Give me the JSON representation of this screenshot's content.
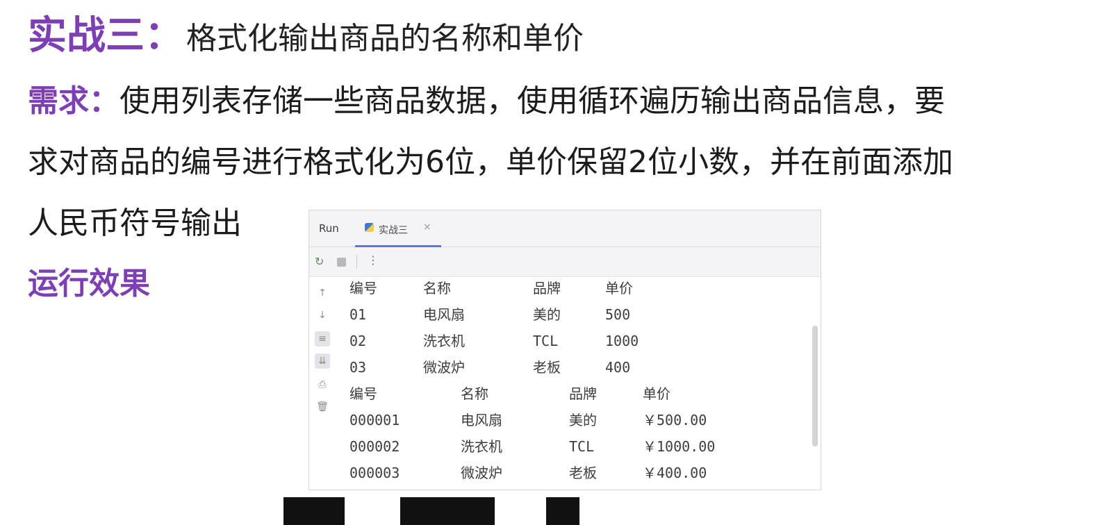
{
  "slide": {
    "title_prefix": "实战三：",
    "title_text": "格式化输出商品的名称和单价",
    "req_label": "需求：",
    "req_line1": "使用列表存储一些商品数据，使用循环遍历输出商品信息，要",
    "req_line2": "求对商品的编号进行格式化为6位，单价保留2位小数，并在前面添加",
    "req_line3": "人民币符号输出",
    "run_heading": "运行效果"
  },
  "ide": {
    "run_label": "Run",
    "tab_label": "实战三",
    "tab_close": "×",
    "icons": [
      "rerun-icon",
      "stop-icon",
      "more-options-icon",
      "arrow-up-icon",
      "arrow-down-icon",
      "soft-wrap-icon",
      "scroll-to-end-icon",
      "print-icon",
      "trash-icon"
    ],
    "icon_glyphs": {
      "rerun": "↻",
      "more": "⋮",
      "up": "↑",
      "down": "↓",
      "wrap": "≡",
      "scroll": "⇊",
      "print": "⎙",
      "trash": "🗑"
    }
  },
  "console": {
    "table1": {
      "headers": [
        "编号",
        "名称",
        "品牌",
        "单价"
      ],
      "rows": [
        [
          "01",
          "电风扇",
          "美的",
          "500"
        ],
        [
          "02",
          "洗衣机",
          "TCL",
          "1000"
        ],
        [
          "03",
          "微波炉",
          "老板",
          "400"
        ]
      ]
    },
    "table2": {
      "headers": [
        "编号",
        "名称",
        "品牌",
        "单价"
      ],
      "rows": [
        [
          "000001",
          "电风扇",
          "美的",
          "￥500.00"
        ],
        [
          "000002",
          "洗衣机",
          "TCL",
          "￥1000.00"
        ],
        [
          "000003",
          "微波炉",
          "老板",
          "￥400.00"
        ]
      ]
    }
  },
  "colors": {
    "accent": "#7e3fb4",
    "tab_underline": "#4a7fdc"
  }
}
